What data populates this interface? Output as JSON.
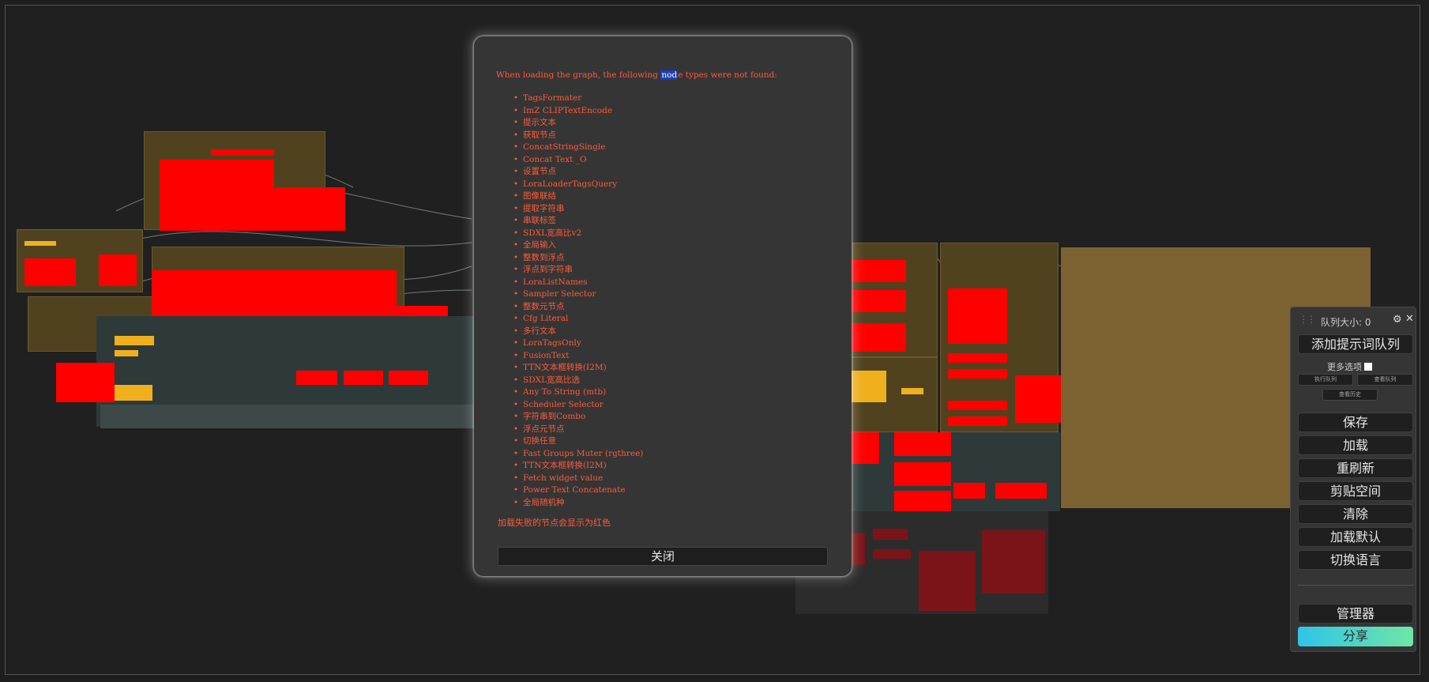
{
  "dialog": {
    "message_before": "When loading the graph, the following ",
    "message_highlight": "nod",
    "message_after": "e types were not found:",
    "missing_nodes": [
      "TagsFormater",
      "ImZ CLIPTextEncode",
      "提示文本",
      "获取节点",
      "ConcatStringSingle",
      "Concat Text _O",
      "设置节点",
      "LoraLoaderTagsQuery",
      "图像联结",
      "提取字符串",
      "串联标签",
      "SDXL宽高比v2",
      "全局输入",
      "整数到浮点",
      "浮点到字符串",
      "LoraListNames",
      "Sampler Selector",
      "整数元节点",
      "Cfg Literal",
      "多行文本",
      "LoraTagsOnly",
      "FusionText",
      "TTN文本框转换(I2M)",
      "SDXL宽高比选",
      "Any To String (mtb)",
      "Scheduler Selector",
      "字符串到Combo",
      "浮点元节点",
      "切换任意",
      "Fast Groups Muter (rgthree)",
      "TTN文本框转换(I2M)",
      "Fetch widget value",
      "Power Text Concatenate",
      "全局随机种"
    ],
    "note": "加载失败的节点会显示为红色",
    "close_label": "关闭"
  },
  "side_panel": {
    "queue_label": "队列大小: 0",
    "queue_prompt": "添加提示词队列",
    "more_options": "更多选项",
    "small_buttons": [
      "执行队列",
      "查看队列",
      "查看历史"
    ],
    "buttons": [
      "保存",
      "加载",
      "重刷新",
      "剪贴空间",
      "清除",
      "加载默认",
      "切换语言"
    ],
    "manager": "管理器",
    "share": "分享"
  },
  "colors": {
    "missing_node": "#ff0000",
    "group_bg": "#7b6230",
    "dialog_bg": "#353535",
    "error_text": "#ff5a3a",
    "share_gradient_start": "#2fc4e8",
    "share_gradient_end": "#6fe6a6"
  },
  "icons": {
    "drag_handle": "drag-handle-icon",
    "settings": "gear-icon",
    "close": "close-icon"
  }
}
